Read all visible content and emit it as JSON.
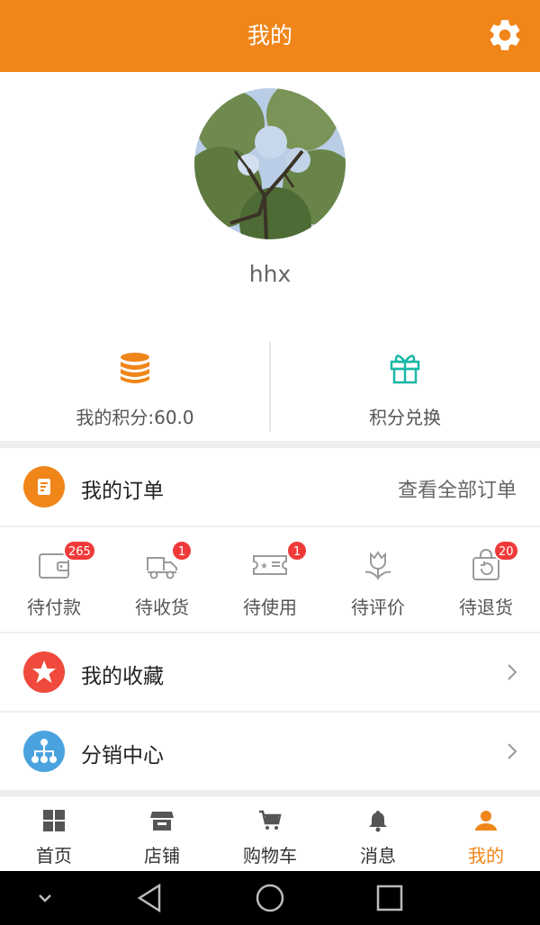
{
  "header": {
    "title": "我的",
    "settings_icon": "gear-icon"
  },
  "profile": {
    "username": "hhx",
    "avatar_icon": "avatar-photo"
  },
  "points": {
    "my_points_label": "我的积分:60.0",
    "exchange_label": "积分兑换"
  },
  "orders": {
    "title": "我的订单",
    "view_all": "查看全部订单",
    "statuses": [
      {
        "label": "待付款",
        "badge": "265"
      },
      {
        "label": "待收货",
        "badge": "1"
      },
      {
        "label": "待使用",
        "badge": "1"
      },
      {
        "label": "待评价",
        "badge": ""
      },
      {
        "label": "待退货",
        "badge": "20"
      }
    ]
  },
  "menu": {
    "favorites": "我的收藏",
    "distribution": "分销中心"
  },
  "tabs": [
    {
      "label": "首页"
    },
    {
      "label": "店铺"
    },
    {
      "label": "购物车"
    },
    {
      "label": "消息"
    },
    {
      "label": "我的"
    }
  ],
  "colors": {
    "accent": "#f08519",
    "badge": "#f03a3a",
    "favorite": "#ef4a3c",
    "distribution": "#4aa3df",
    "gift": "#19b7a6"
  }
}
